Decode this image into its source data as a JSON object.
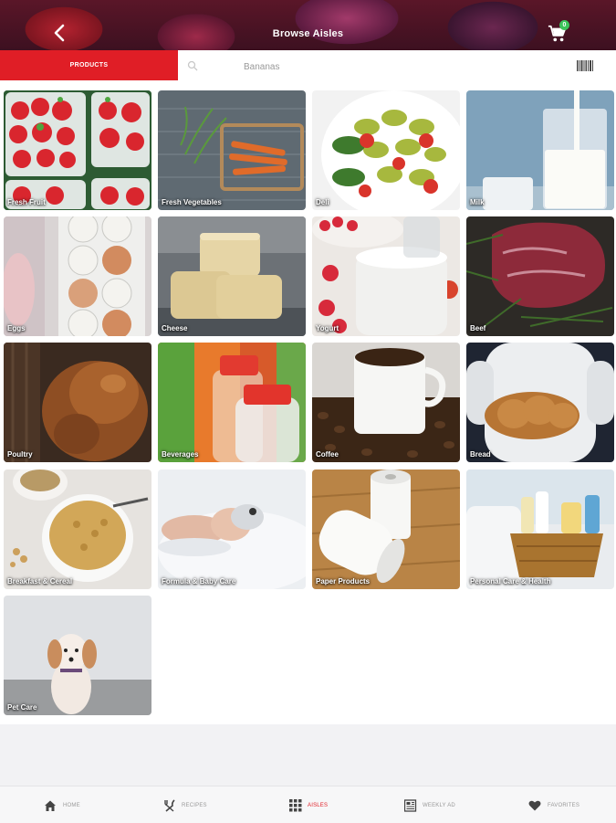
{
  "header": {
    "title": "Browse Aisles",
    "back_icon": "chevron-left-icon",
    "cart_icon": "shopping-cart-icon",
    "cart_count": "0"
  },
  "search": {
    "tab_label": "PRODUCTS",
    "placeholder": "Bananas",
    "value": "",
    "search_icon": "search-icon",
    "barcode_icon": "barcode-icon"
  },
  "aisles": [
    {
      "label": "Fresh Fruit"
    },
    {
      "label": "Fresh Vegetables"
    },
    {
      "label": "Deli"
    },
    {
      "label": "Milk"
    },
    {
      "label": "Eggs"
    },
    {
      "label": "Cheese"
    },
    {
      "label": "Yogurt"
    },
    {
      "label": "Beef"
    },
    {
      "label": "Poultry"
    },
    {
      "label": "Beverages"
    },
    {
      "label": "Coffee"
    },
    {
      "label": "Bread"
    },
    {
      "label": "Breakfast & Cereal"
    },
    {
      "label": "Formula & Baby Care"
    },
    {
      "label": "Paper Products"
    },
    {
      "label": "Personal Care & Health"
    },
    {
      "label": "Pet Care"
    }
  ],
  "nav": {
    "items": [
      {
        "label": "HOME",
        "icon": "home-icon"
      },
      {
        "label": "RECIPES",
        "icon": "fork-knife-icon"
      },
      {
        "label": "AISLES",
        "icon": "grid-icon",
        "active": true
      },
      {
        "label": "WEEKLY AD",
        "icon": "newspaper-icon"
      },
      {
        "label": "FAVORITES",
        "icon": "heart-icon"
      }
    ]
  },
  "colors": {
    "accent": "#e01e26",
    "badge": "#3cc45a"
  }
}
